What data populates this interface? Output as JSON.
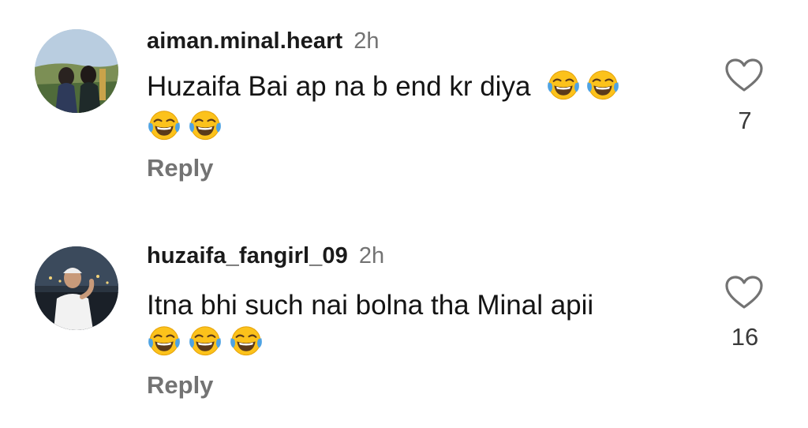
{
  "comments": [
    {
      "username": "aiman.minal.heart",
      "time": "2h",
      "text": "Huzaifa Bai ap na b end kr diya",
      "emoji": "face-with-tears-of-joy",
      "likes": "7",
      "reply_label": "Reply"
    },
    {
      "username": "huzaifa_fangirl_09",
      "time": "2h",
      "text": "Itna bhi such nai bolna tha Minal apii",
      "emoji": "face-with-tears-of-joy",
      "likes": "16",
      "reply_label": "Reply"
    }
  ],
  "colors": {
    "username": "#1a1a1a",
    "secondary": "#737373",
    "emoji_face": "#fcc21b"
  }
}
